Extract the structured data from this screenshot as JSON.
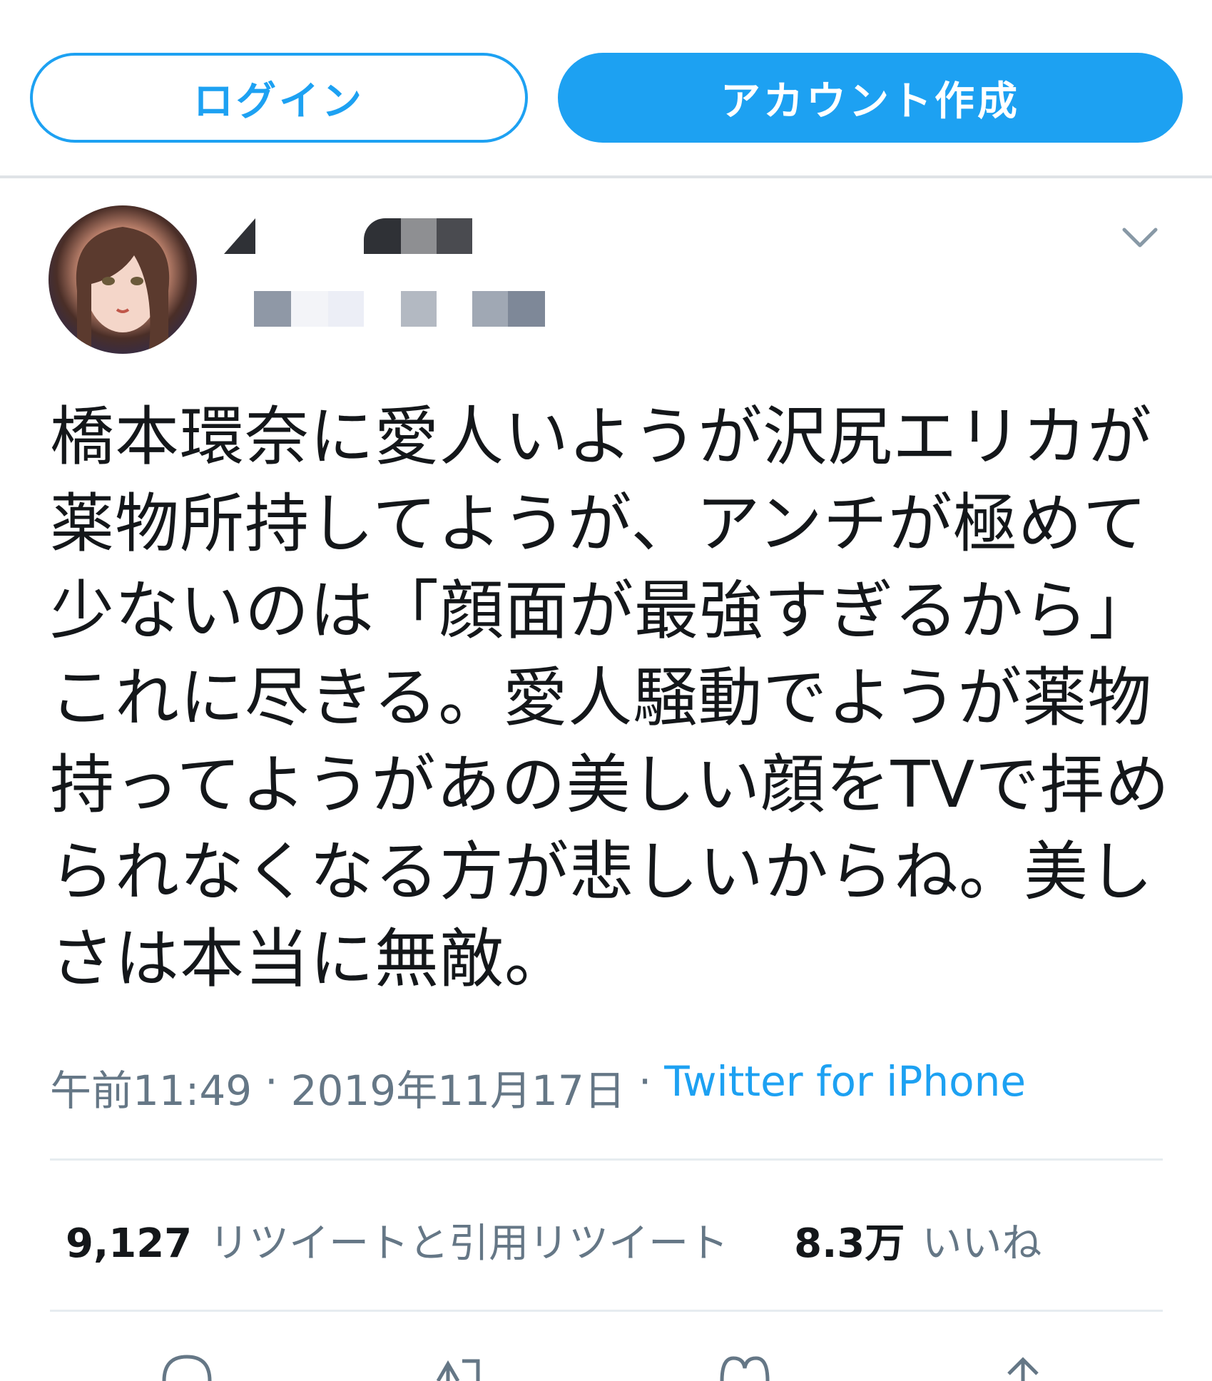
{
  "header": {
    "login_label": "ログイン",
    "signup_label": "アカウント作成",
    "accent": "#1da1f2"
  },
  "tweet": {
    "avatar_icon": "user-avatar",
    "menu_icon": "chevron-down-icon",
    "text_lines": [
      "橋本環奈に愛人いようが沢尻エリカが",
      "薬物所持してようが、アンチが極めて",
      "少ないのは「顔面が最強すぎるから」",
      "これに尽きる。愛人騒動でようが薬物",
      "持ってようがあの美しい顔をTVで拝め",
      "られなくなる方が悲しいからね。美し",
      "さは本当に無敵。"
    ],
    "time": "午前11:49",
    "separator": "·",
    "date": "2019年11月17日",
    "source": "Twitter for iPhone"
  },
  "stats": {
    "retweet_count": "9,127",
    "retweet_label": "リツイートと引用リツイート",
    "like_count": "8.3万",
    "like_label": "いいね"
  },
  "actions": {
    "icons": [
      "reply-icon",
      "retweet-icon",
      "like-icon",
      "share-icon"
    ]
  }
}
